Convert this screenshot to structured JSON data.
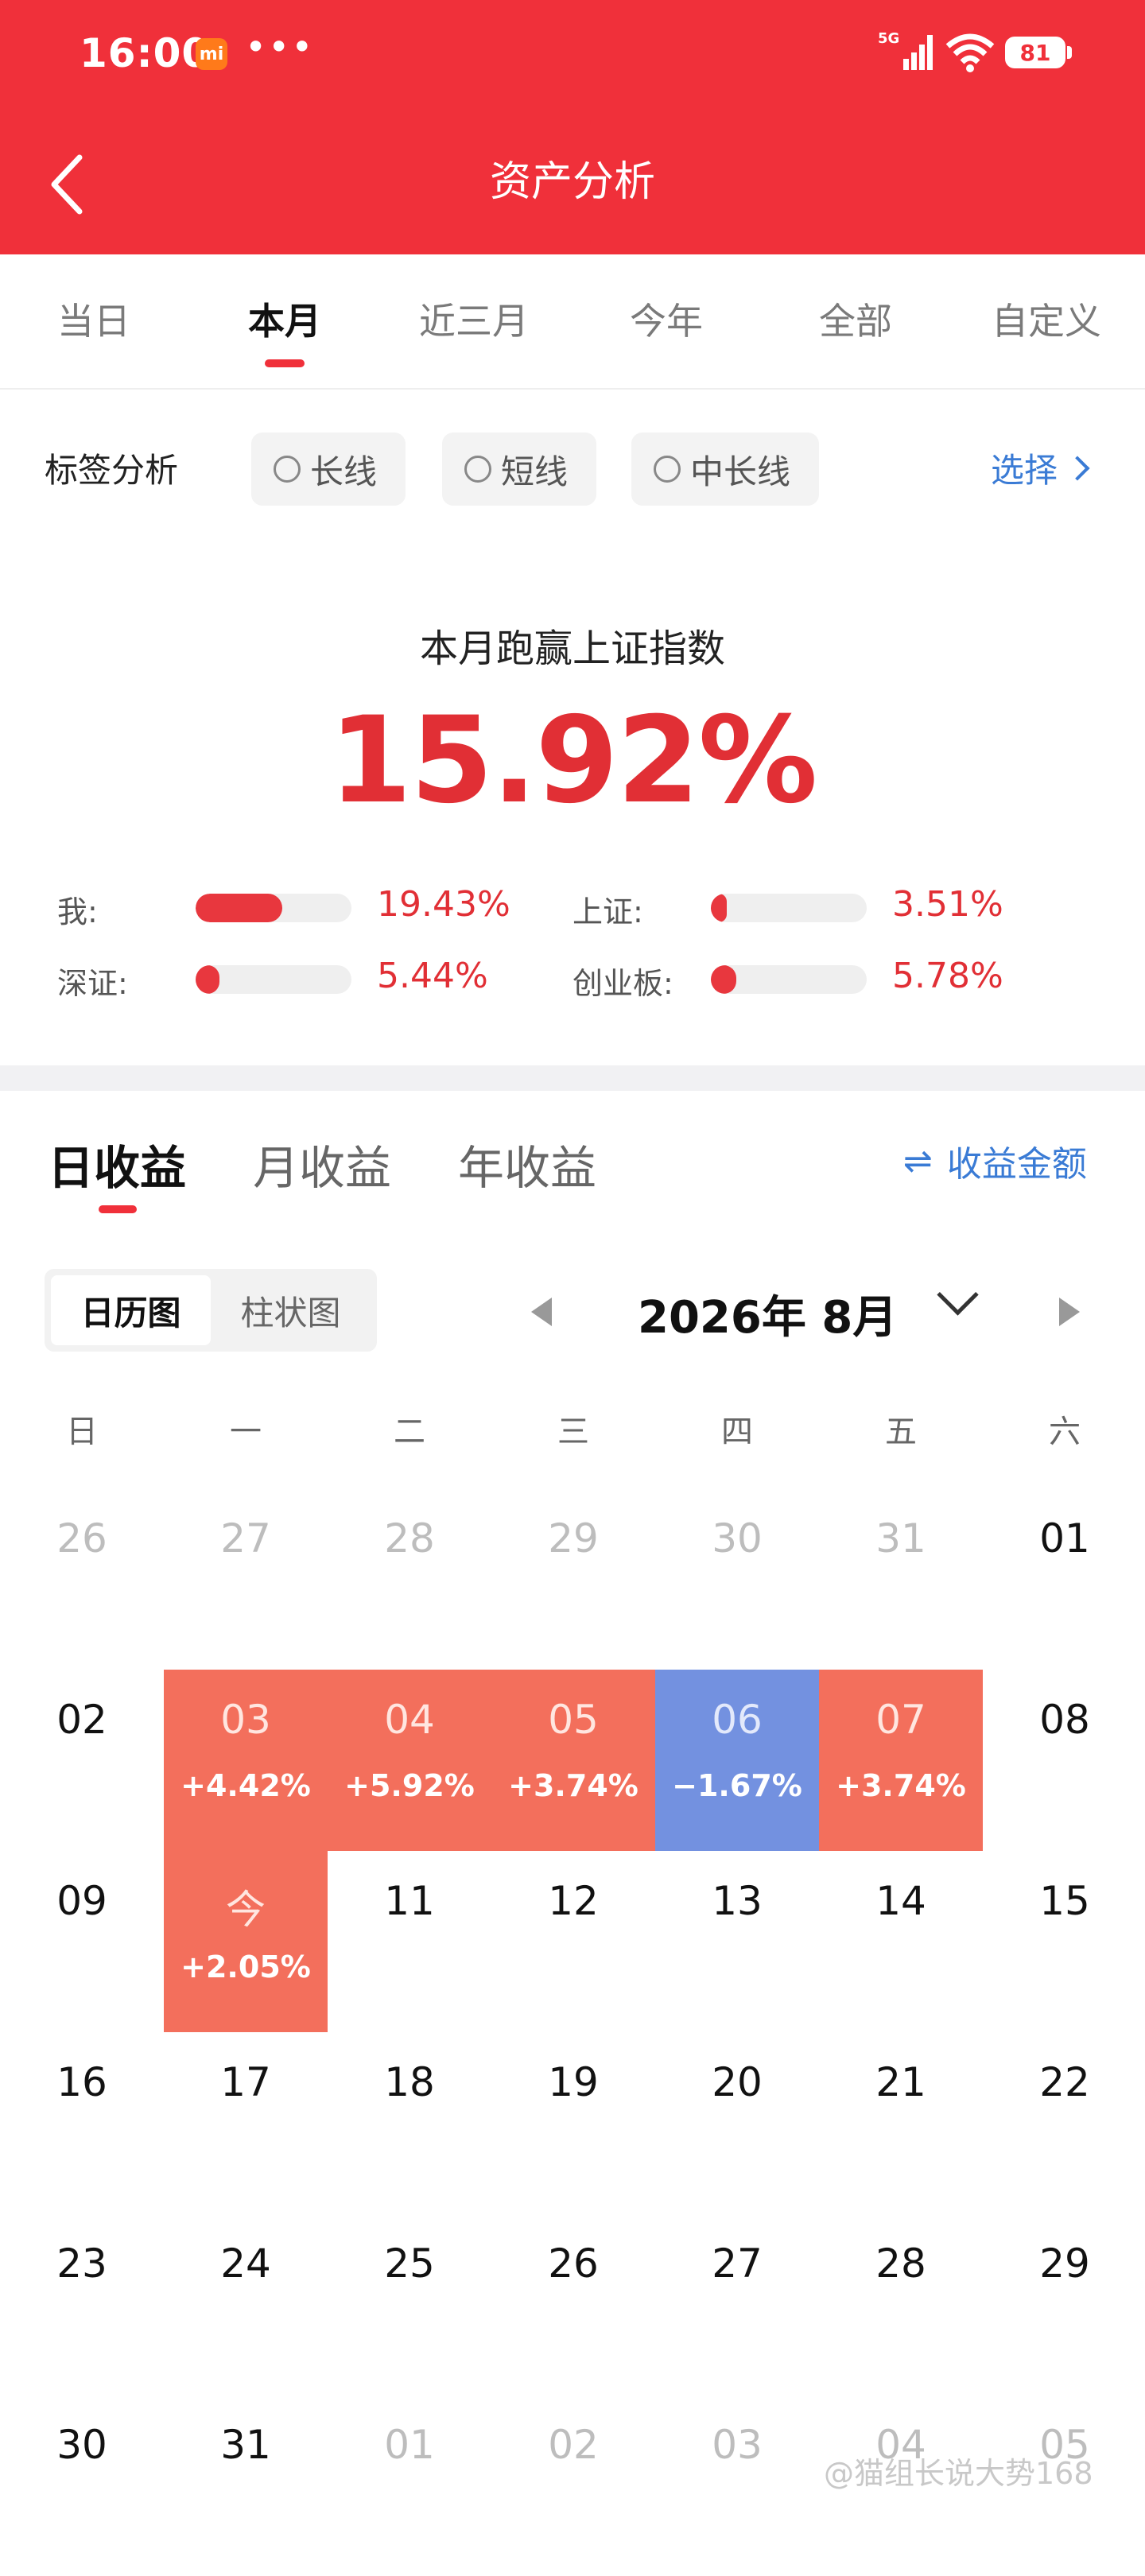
{
  "status_bar": {
    "time": "16:00",
    "app_badge": "mi",
    "dots": "•••",
    "network": "5G",
    "battery": "81"
  },
  "nav": {
    "title": "资产分析"
  },
  "period_tabs": [
    "当日",
    "本月",
    "近三月",
    "今年",
    "全部",
    "自定义"
  ],
  "period_active": 1,
  "tag_filter": {
    "label": "标签分析",
    "options": [
      "长线",
      "短线",
      "中长线"
    ],
    "select_label": "选择"
  },
  "summary": {
    "title": "本月跑赢上证指数",
    "value": "15.92%",
    "comparisons": [
      {
        "label": "我:",
        "value": "19.43%",
        "pct": 19.43
      },
      {
        "label": "上证:",
        "value": "3.51%",
        "pct": 3.51
      },
      {
        "label": "深证:",
        "value": "5.44%",
        "pct": 5.44
      },
      {
        "label": "创业板:",
        "value": "5.78%",
        "pct": 5.78
      }
    ]
  },
  "return_tabs": [
    "日收益",
    "月收益",
    "年收益"
  ],
  "amount_toggle": {
    "icon": "swap-icon",
    "label": "收益金额"
  },
  "view_toggle": [
    "日历图",
    "柱状图"
  ],
  "month": {
    "label": "2026年 8月"
  },
  "weekdays": [
    "日",
    "一",
    "二",
    "三",
    "四",
    "五",
    "六"
  ],
  "calendar": [
    [
      {
        "d": "26",
        "m": 1
      },
      {
        "d": "27",
        "m": 1
      },
      {
        "d": "28",
        "m": 1
      },
      {
        "d": "29",
        "m": 1
      },
      {
        "d": "30",
        "m": 1
      },
      {
        "d": "31",
        "m": 1
      },
      {
        "d": "01"
      }
    ],
    [
      {
        "d": "02"
      },
      {
        "d": "03",
        "r": "+4.42%",
        "t": "up"
      },
      {
        "d": "04",
        "r": "+5.92%",
        "t": "up"
      },
      {
        "d": "05",
        "r": "+3.74%",
        "t": "up"
      },
      {
        "d": "06",
        "r": "−1.67%",
        "t": "down"
      },
      {
        "d": "07",
        "r": "+3.74%",
        "t": "up"
      },
      {
        "d": "08"
      }
    ],
    [
      {
        "d": "09"
      },
      {
        "d": "今",
        "r": "+2.05%",
        "t": "up"
      },
      {
        "d": "11"
      },
      {
        "d": "12"
      },
      {
        "d": "13"
      },
      {
        "d": "14"
      },
      {
        "d": "15"
      }
    ],
    [
      {
        "d": "16"
      },
      {
        "d": "17"
      },
      {
        "d": "18"
      },
      {
        "d": "19"
      },
      {
        "d": "20"
      },
      {
        "d": "21"
      },
      {
        "d": "22"
      }
    ],
    [
      {
        "d": "23"
      },
      {
        "d": "24"
      },
      {
        "d": "25"
      },
      {
        "d": "26"
      },
      {
        "d": "27"
      },
      {
        "d": "28"
      },
      {
        "d": "29"
      }
    ],
    [
      {
        "d": "30"
      },
      {
        "d": "31"
      },
      {
        "d": "01",
        "m": 1
      },
      {
        "d": "02",
        "m": 1
      },
      {
        "d": "03",
        "m": 1
      },
      {
        "d": "04",
        "m": 1
      },
      {
        "d": "05",
        "m": 1
      }
    ]
  ],
  "watermark": "@猫组长说大势168",
  "colors": {
    "brand": "#f0303a",
    "gain": "#f36f5c",
    "loss": "#7391e0",
    "link": "#3a7bd5"
  }
}
